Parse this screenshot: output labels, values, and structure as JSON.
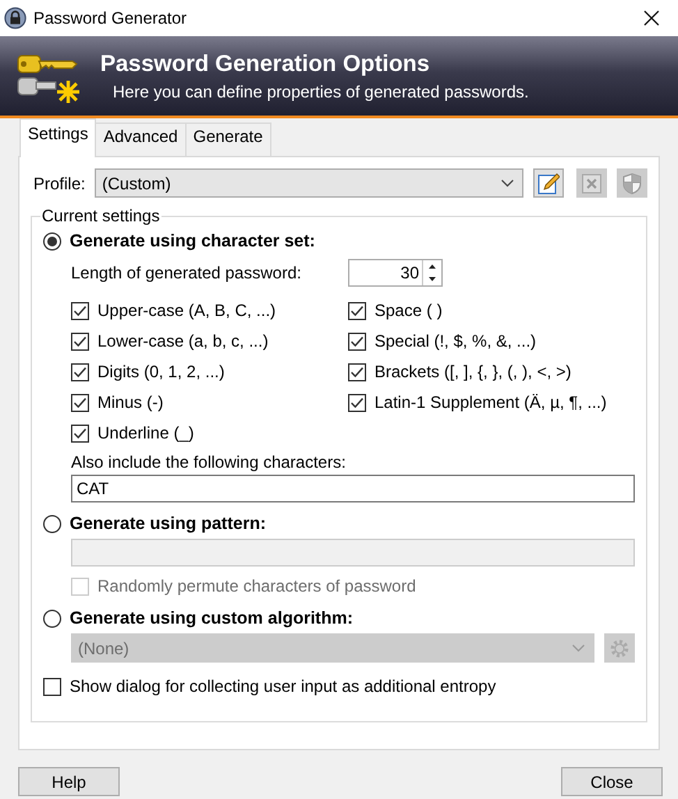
{
  "window": {
    "title": "Password Generator"
  },
  "banner": {
    "title": "Password Generation Options",
    "subtitle": "Here you can define properties of generated passwords."
  },
  "tabs": [
    {
      "label": "Settings",
      "selected": true
    },
    {
      "label": "Advanced",
      "selected": false
    },
    {
      "label": "Generate",
      "selected": false
    }
  ],
  "profile": {
    "label": "Profile:",
    "value": "(Custom)"
  },
  "group": {
    "title": "Current settings"
  },
  "charset_mode": {
    "label": "Generate using character set:",
    "selected": true,
    "length_label": "Length of generated password:",
    "length": "30",
    "sets_left": [
      {
        "label": "Upper-case (A, B, C, ...)",
        "checked": true
      },
      {
        "label": "Lower-case (a, b, c, ...)",
        "checked": true
      },
      {
        "label": "Digits (0, 1, 2, ...)",
        "checked": true
      },
      {
        "label": "Minus (-)",
        "checked": true
      },
      {
        "label": "Underline (_)",
        "checked": true
      }
    ],
    "sets_right": [
      {
        "label": "Space ( )",
        "checked": true
      },
      {
        "label": "Special (!, $, %, &, ...)",
        "checked": true
      },
      {
        "label": "Brackets ([, ], {, }, (, ), <, >)",
        "checked": true
      },
      {
        "label": "Latin-1 Supplement (Ä, µ, ¶, ...)",
        "checked": true
      }
    ],
    "also_label": "Also include the following characters:",
    "also_value": "CAT"
  },
  "pattern_mode": {
    "label": "Generate using pattern:",
    "selected": false,
    "disabled": true,
    "permute": {
      "label": "Randomly permute characters of password",
      "checked": false
    }
  },
  "algorithm_mode": {
    "label": "Generate using custom algorithm:",
    "selected": false,
    "disabled": true,
    "value": "(None)"
  },
  "entropy": {
    "label": "Show dialog for collecting user input as additional entropy",
    "checked": false
  },
  "buttons": [
    "Help",
    "Close"
  ]
}
